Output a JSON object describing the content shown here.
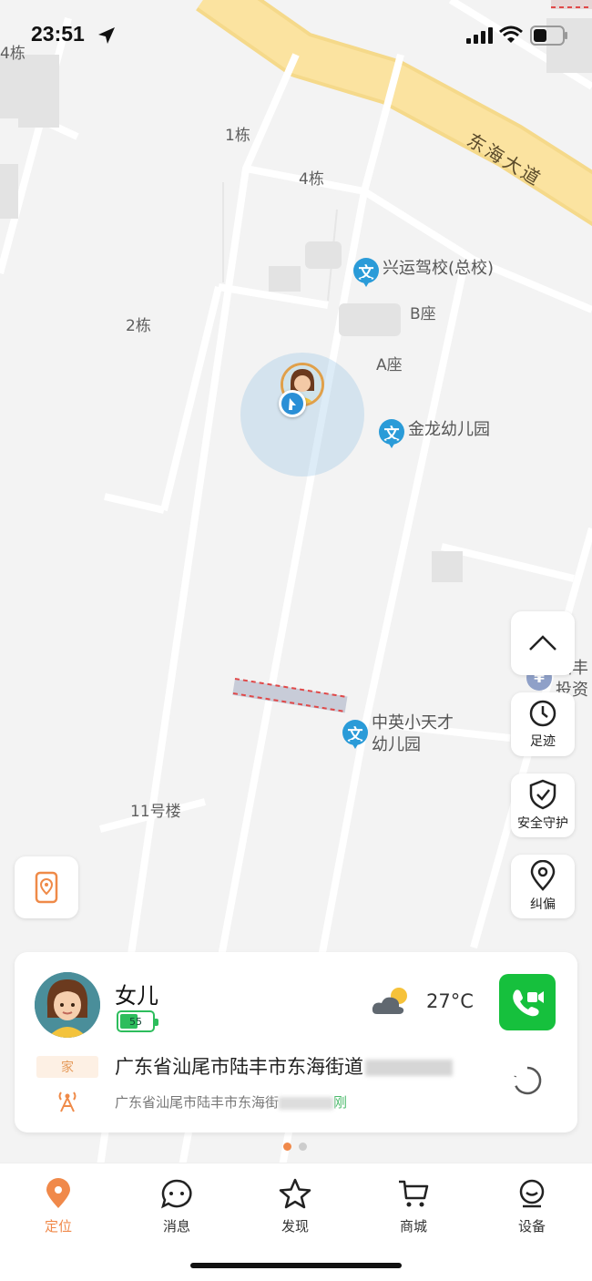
{
  "status_bar": {
    "time": "23:51"
  },
  "map": {
    "road_label": "东海大道",
    "labels": [
      "4栋",
      "1栋",
      "4栋",
      "2栋",
      "B座",
      "A座",
      "11号楼"
    ],
    "pois": [
      {
        "icon": "文",
        "name": "兴运驾校(总校)"
      },
      {
        "icon": "文",
        "name": "金龙幼儿园"
      },
      {
        "icon": "文",
        "name": "中英小天才\n幼儿园"
      },
      {
        "icon": "¥",
        "name": "陆丰\n投资"
      }
    ]
  },
  "side_buttons": {
    "track": "足迹",
    "safety": "安全守护",
    "correct": "纠偏"
  },
  "card": {
    "name": "女儿",
    "battery": "55",
    "battery_level": 0.55,
    "temperature": "27°C",
    "home_tag": "家",
    "address_main": "广东省汕尾市陆丰市东海街道",
    "address_sub": "广东省汕尾市陆丰市东海街",
    "address_sub_tail": "刚"
  },
  "tabs": [
    {
      "label": "定位",
      "active": true
    },
    {
      "label": "消息"
    },
    {
      "label": "发现"
    },
    {
      "label": "商城"
    },
    {
      "label": "设备"
    }
  ],
  "colors": {
    "accent": "#f0894a",
    "call_green": "#16c03d",
    "poi_blue": "#2a9bd8"
  }
}
